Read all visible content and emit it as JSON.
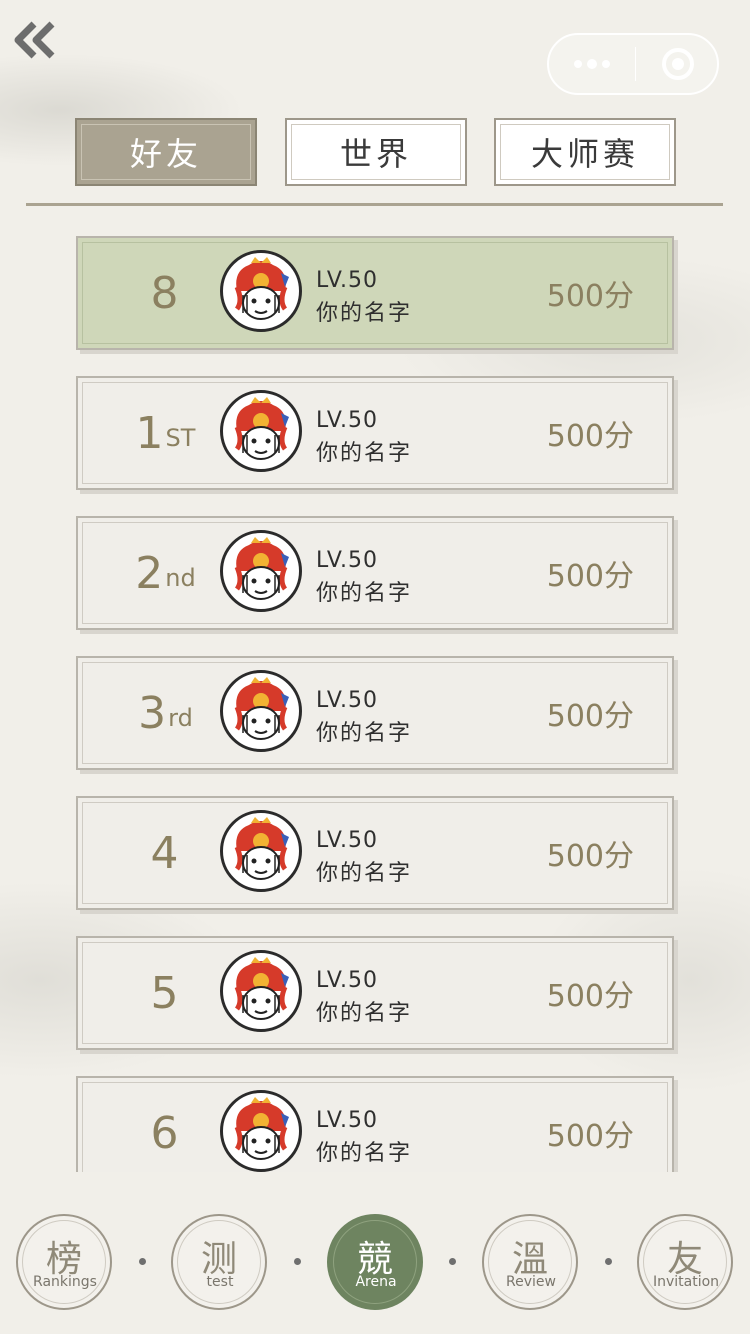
{
  "tabs": [
    {
      "label": "好友",
      "active": true
    },
    {
      "label": "世界",
      "active": false
    },
    {
      "label": "大师赛",
      "active": false
    }
  ],
  "rows": [
    {
      "rank": "8",
      "suffix": "",
      "level": "LV.50",
      "name": "你的名字",
      "score": "500分",
      "highlight": true
    },
    {
      "rank": "1",
      "suffix": "ST",
      "level": "LV.50",
      "name": "你的名字",
      "score": "500分",
      "highlight": false
    },
    {
      "rank": "2",
      "suffix": "nd",
      "level": "LV.50",
      "name": "你的名字",
      "score": "500分",
      "highlight": false
    },
    {
      "rank": "3",
      "suffix": "rd",
      "level": "LV.50",
      "name": "你的名字",
      "score": "500分",
      "highlight": false
    },
    {
      "rank": "4",
      "suffix": "",
      "level": "LV.50",
      "name": "你的名字",
      "score": "500分",
      "highlight": false
    },
    {
      "rank": "5",
      "suffix": "",
      "level": "LV.50",
      "name": "你的名字",
      "score": "500分",
      "highlight": false
    },
    {
      "rank": "6",
      "suffix": "",
      "level": "LV.50",
      "name": "你的名字",
      "score": "500分",
      "highlight": false
    }
  ],
  "nav": [
    {
      "char": "榜",
      "label": "Rankings",
      "active": false
    },
    {
      "char": "测",
      "label": "test",
      "active": false
    },
    {
      "char": "競",
      "label": "Arena",
      "active": true
    },
    {
      "char": "溫",
      "label": "Review",
      "active": false
    },
    {
      "char": "友",
      "label": "Invitation",
      "active": false
    }
  ],
  "icons": {
    "back": "double-chevron-left-icon",
    "more": "more-dots-icon",
    "close": "target-circle-icon",
    "avatar": "lion-dance-avatar"
  },
  "colors": {
    "highlight_row": "#cfd7b9",
    "active_tab": "#aaa391",
    "active_nav": "#6e8460",
    "accent_text": "#8b8060"
  }
}
